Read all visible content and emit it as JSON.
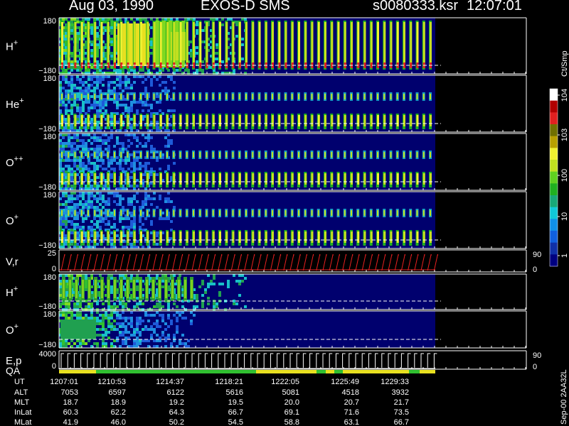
{
  "header": {
    "date": "Aug 03, 1990",
    "instrument": "EXOS-D SMS",
    "file": "s0080333.ksr",
    "time": "12:07:01"
  },
  "colorbar": {
    "unit_label": "Ct/Smp",
    "tick_labels": [
      "1",
      "10",
      "100",
      "10^3",
      "10^4"
    ],
    "stops": [
      "#000080",
      "#1030a8",
      "#1060e0",
      "#1090e8",
      "#10c8d8",
      "#18a878",
      "#20b020",
      "#60d020",
      "#c0e020",
      "#f0f030",
      "#b8a000",
      "#707000",
      "#e02020",
      "#b00000",
      "#ffffff"
    ]
  },
  "panels": [
    {
      "id": "h1",
      "label": "H",
      "sup": "+",
      "ytop": "180",
      "ybot": "−180"
    },
    {
      "id": "he",
      "label": "He",
      "sup": "+",
      "ytop": "180",
      "ybot": "−180"
    },
    {
      "id": "opp",
      "label": "O",
      "sup": "++",
      "ytop": "180",
      "ybot": "−180"
    },
    {
      "id": "o1",
      "label": "O",
      "sup": "+",
      "ytop": "180",
      "ybot": "−180"
    },
    {
      "id": "vr",
      "label": "V,r",
      "sup": "",
      "ytop": "25",
      "ybot": "0",
      "right_top": "90",
      "right_bot": "0"
    },
    {
      "id": "h2",
      "label": "H",
      "sup": "+",
      "ytop": "180",
      "ybot": "−180"
    },
    {
      "id": "o2",
      "label": "O",
      "sup": "+",
      "ytop": "180",
      "ybot": "−180"
    },
    {
      "id": "ep",
      "label": "E,p",
      "sup": "",
      "label2": "QA",
      "ytop": "4000",
      "ybot": "0",
      "right_top": "90",
      "right_bot": "0"
    }
  ],
  "ephemeris": {
    "rows": [
      "UT",
      "ALT",
      "MLT",
      "InLat",
      "MLat"
    ],
    "columns": [
      [
        "1207:01",
        "7053",
        "18.7",
        "60.3",
        "41.9"
      ],
      [
        "1210:53",
        "6597",
        "18.9",
        "62.2",
        "46.0"
      ],
      [
        "1214:37",
        "6122",
        "19.2",
        "64.3",
        "50.2"
      ],
      [
        "1218:21",
        "5616",
        "19.5",
        "66.7",
        "54.5"
      ],
      [
        "1222:05",
        "5081",
        "20.0",
        "69.1",
        "58.8"
      ],
      [
        "1225:49",
        "4518",
        "20.7",
        "71.6",
        "63.1"
      ],
      [
        "1229:33",
        "3932",
        "21.7",
        "73.5",
        "66.7"
      ]
    ]
  },
  "footer_note": "Sep-00 2AA32L",
  "chart_data": {
    "type": "heatmap",
    "title": "Aug 03, 1990   EXOS-D SMS",
    "x_ticks_ut": [
      "1207:01",
      "1210:53",
      "1214:37",
      "1218:21",
      "1222:05",
      "1225:49",
      "1229:33"
    ],
    "panels": [
      "H+",
      "He+",
      "O++",
      "O+",
      "V,r",
      "H+",
      "O+",
      "E,p / QA"
    ],
    "pitch_angle_range": [
      -180,
      180
    ],
    "colorbar_range": [
      1,
      10000
    ],
    "colorbar_scale": "log",
    "colorbar_unit": "Ct/Smp"
  }
}
